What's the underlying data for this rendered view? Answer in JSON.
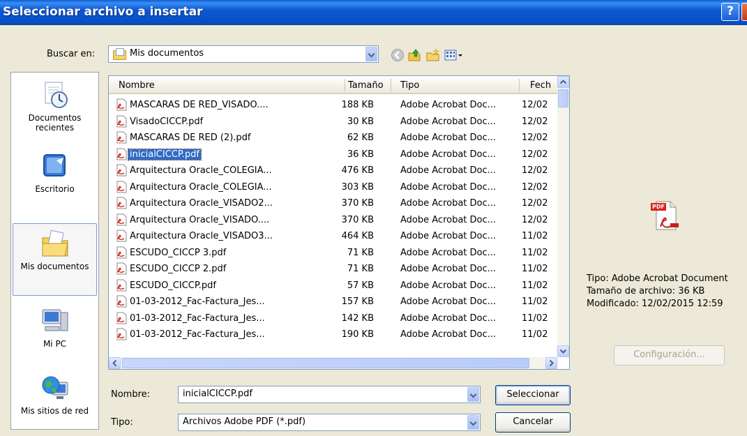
{
  "window": {
    "title": "Seleccionar archivo a insertar",
    "help": "?"
  },
  "lookin": {
    "label": "Buscar en:",
    "value": "Mis documentos"
  },
  "places": [
    {
      "label": "Documentos recientes"
    },
    {
      "label": "Escritorio"
    },
    {
      "label": "Mis documentos"
    },
    {
      "label": "Mi PC"
    },
    {
      "label": "Mis sitios de red"
    }
  ],
  "columns": {
    "name": "Nombre",
    "size": "Tamaño",
    "type": "Tipo",
    "date": "Fech"
  },
  "files": [
    {
      "name": "MASCARAS DE RED_VISADO....",
      "size": "188 KB",
      "type": "Adobe Acrobat Doc...",
      "date": "12/02"
    },
    {
      "name": "VisadoCICCP.pdf",
      "size": "30 KB",
      "type": "Adobe Acrobat Doc...",
      "date": "12/02"
    },
    {
      "name": "MASCARAS DE RED (2).pdf",
      "size": "62 KB",
      "type": "Adobe Acrobat Doc...",
      "date": "12/02"
    },
    {
      "name": "inicialCICCP.pdf",
      "size": "36 KB",
      "type": "Adobe Acrobat Doc...",
      "date": "12/02"
    },
    {
      "name": "Arquitectura Oracle_COLEGIA...",
      "size": "476 KB",
      "type": "Adobe Acrobat Doc...",
      "date": "12/02"
    },
    {
      "name": "Arquitectura Oracle_COLEGIA...",
      "size": "303 KB",
      "type": "Adobe Acrobat Doc...",
      "date": "12/02"
    },
    {
      "name": "Arquitectura Oracle_VISADO2...",
      "size": "370 KB",
      "type": "Adobe Acrobat Doc...",
      "date": "12/02"
    },
    {
      "name": "Arquitectura Oracle_VISADO....",
      "size": "370 KB",
      "type": "Adobe Acrobat Doc...",
      "date": "12/02"
    },
    {
      "name": "Arquitectura Oracle_VISADO3...",
      "size": "464 KB",
      "type": "Adobe Acrobat Doc...",
      "date": "11/02"
    },
    {
      "name": "ESCUDO_CICCP 3.pdf",
      "size": "71 KB",
      "type": "Adobe Acrobat Doc...",
      "date": "11/02"
    },
    {
      "name": "ESCUDO_CICCP 2.pdf",
      "size": "71 KB",
      "type": "Adobe Acrobat Doc...",
      "date": "11/02"
    },
    {
      "name": "ESCUDO_CICCP.pdf",
      "size": "57 KB",
      "type": "Adobe Acrobat Doc...",
      "date": "11/02"
    },
    {
      "name": "01-03-2012_Fac-Factura_Jes...",
      "size": "157 KB",
      "type": "Adobe Acrobat Doc...",
      "date": "11/02"
    },
    {
      "name": "01-03-2012_Fac-Factura_Jes...",
      "size": "142 KB",
      "type": "Adobe Acrobat Doc...",
      "date": "11/02"
    },
    {
      "name": "01-03-2012_Fac-Factura_Jes...",
      "size": "190 KB",
      "type": "Adobe Acrobat Doc...",
      "date": "11/02"
    }
  ],
  "filename": {
    "label": "Nombre:",
    "value": "inicialCICCP.pdf"
  },
  "filetype": {
    "label": "Tipo:",
    "value": "Archivos Adobe PDF (*.pdf)"
  },
  "buttons": {
    "select": "Seleccionar",
    "cancel": "Cancelar",
    "config": "Configuración..."
  },
  "preview": {
    "icon_text": "PDF",
    "type": "Tipo: Adobe Acrobat Document",
    "size": "Tamaño de archivo: 36 KB",
    "modified": "Modificado: 12/02/2015 12:59"
  },
  "colors": {
    "titlebar": "#0a4fc4",
    "selection": "#316ac5",
    "dialog_bg": "#ece9d8"
  }
}
